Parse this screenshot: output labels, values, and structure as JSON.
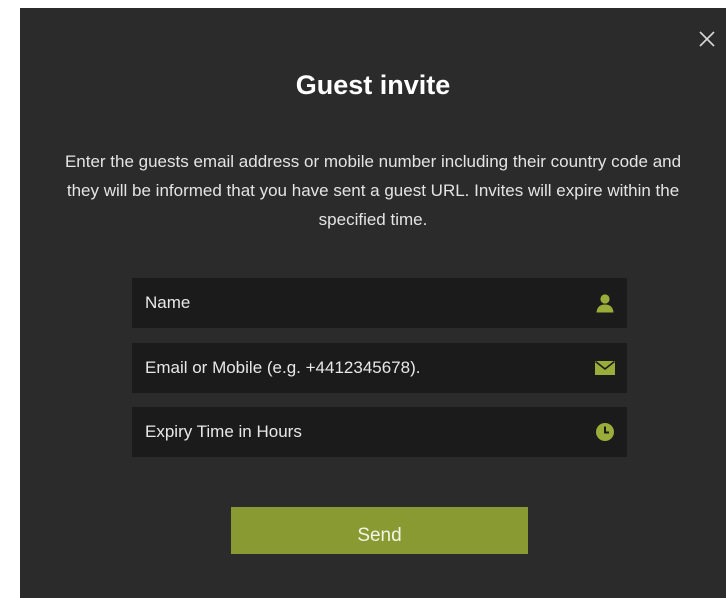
{
  "dialog": {
    "title": "Guest invite",
    "description": "Enter the guests email address or mobile number including their country code and they will be informed that you have sent a guest URL. Invites will expire within the specified time.",
    "close_icon": "close-icon"
  },
  "form": {
    "name": {
      "placeholder": "Name",
      "value": "",
      "icon": "user-icon"
    },
    "contact": {
      "placeholder": "Email or Mobile (e.g. +4412345678).",
      "value": "",
      "icon": "envelope-icon"
    },
    "expiry": {
      "placeholder": "Expiry Time in Hours",
      "value": "",
      "icon": "clock-icon"
    },
    "send_label": "Send"
  },
  "colors": {
    "dialog_background": "#2b2b2b",
    "field_background": "#1b1b1b",
    "accent": "#8a9a33",
    "icon_accent": "#9aad3a"
  }
}
